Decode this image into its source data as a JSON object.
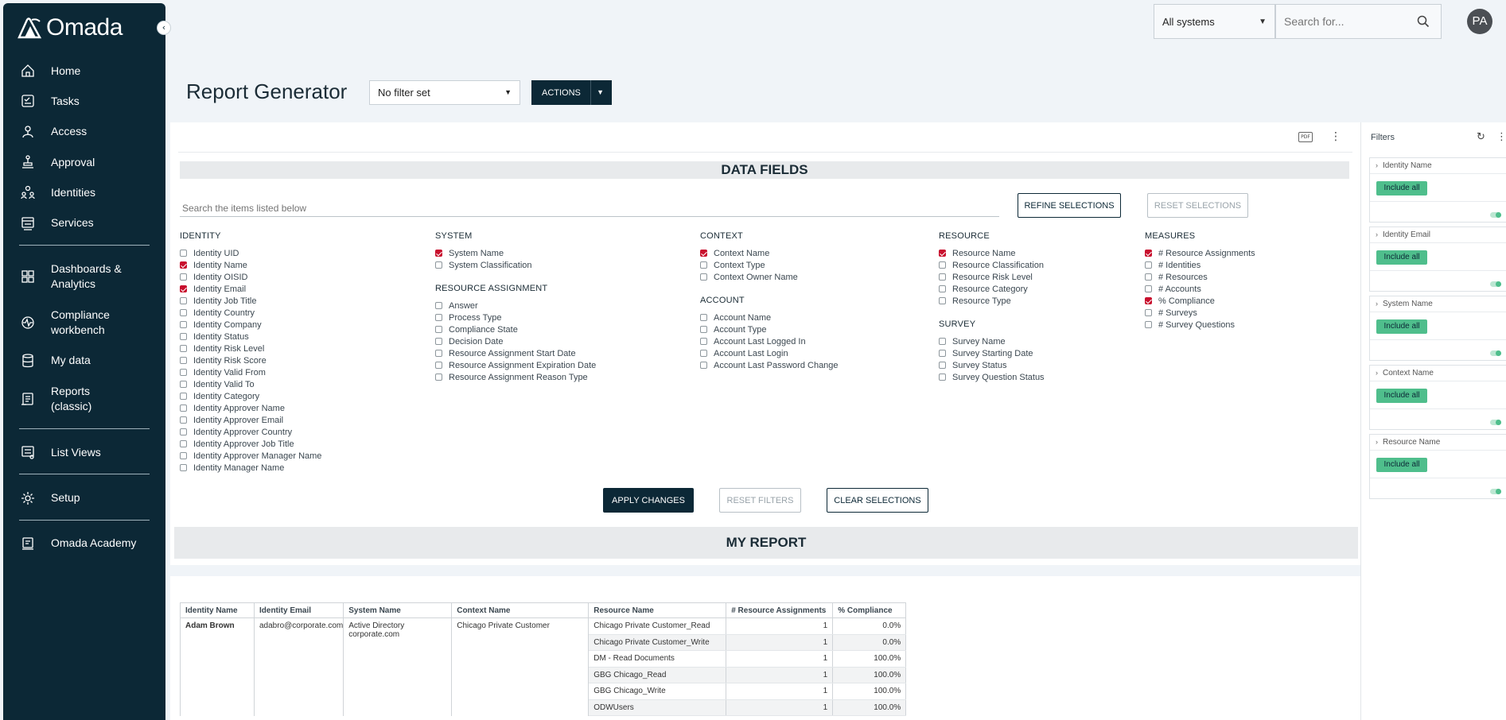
{
  "app": {
    "logo_text": "Omada"
  },
  "sidebar": {
    "items": [
      {
        "label": "Home",
        "icon": "home-icon"
      },
      {
        "label": "Tasks",
        "icon": "tasks-icon"
      },
      {
        "label": "Access",
        "icon": "access-icon"
      },
      {
        "label": "Approval",
        "icon": "approval-icon"
      },
      {
        "label": "Identities",
        "icon": "identities-icon"
      },
      {
        "label": "Services",
        "icon": "services-icon"
      },
      {
        "label": "Dashboards & Analytics",
        "icon": "dashboards-icon"
      },
      {
        "label": "Compliance workbench",
        "icon": "compliance-icon"
      },
      {
        "label": "My data",
        "icon": "database-icon"
      },
      {
        "label": "Reports (classic)",
        "icon": "reports-icon"
      },
      {
        "label": "List Views",
        "icon": "list-views-icon"
      },
      {
        "label": "Setup",
        "icon": "gear-icon"
      },
      {
        "label": "Omada Academy",
        "icon": "academy-icon"
      }
    ]
  },
  "topbar": {
    "system_select": "All systems",
    "search_placeholder": "Search for...",
    "avatar_initials": "PA"
  },
  "header": {
    "title": "Report Generator",
    "filter_select": "No filter set",
    "actions_label": "ACTIONS"
  },
  "data_fields": {
    "title": "DATA FIELDS",
    "search_placeholder": "Search the items listed below",
    "refine_label": "REFINE SELECTIONS",
    "reset_selections_label": "RESET SELECTIONS",
    "groups": {
      "identity": {
        "title": "IDENTITY",
        "items": [
          {
            "label": "Identity UID",
            "checked": false
          },
          {
            "label": "Identity Name",
            "checked": true
          },
          {
            "label": "Identity OISID",
            "checked": false
          },
          {
            "label": "Identity Email",
            "checked": true
          },
          {
            "label": "Identity Job Title",
            "checked": false
          },
          {
            "label": "Identity Country",
            "checked": false
          },
          {
            "label": "Identity Company",
            "checked": false
          },
          {
            "label": "Identity Status",
            "checked": false
          },
          {
            "label": "Identity Risk Level",
            "checked": false
          },
          {
            "label": "Identity Risk Score",
            "checked": false
          },
          {
            "label": "Identity Valid From",
            "checked": false
          },
          {
            "label": "Identity Valid To",
            "checked": false
          },
          {
            "label": "Identity Category",
            "checked": false
          },
          {
            "label": "Identity Approver Name",
            "checked": false
          },
          {
            "label": "Identity Approver Email",
            "checked": false
          },
          {
            "label": "Identity Approver Country",
            "checked": false
          },
          {
            "label": "Identity Approver Job Title",
            "checked": false
          },
          {
            "label": "Identity Approver Manager Name",
            "checked": false
          },
          {
            "label": "Identity Manager Name",
            "checked": false
          }
        ]
      },
      "system": {
        "title": "SYSTEM",
        "items": [
          {
            "label": "System Name",
            "checked": true
          },
          {
            "label": "System Classification",
            "checked": false
          }
        ]
      },
      "resource_assignment": {
        "title": "RESOURCE ASSIGNMENT",
        "items": [
          {
            "label": "Answer",
            "checked": false
          },
          {
            "label": "Process Type",
            "checked": false
          },
          {
            "label": "Compliance State",
            "checked": false
          },
          {
            "label": "Decision Date",
            "checked": false
          },
          {
            "label": "Resource Assignment Start Date",
            "checked": false
          },
          {
            "label": "Resource Assignment Expiration Date",
            "checked": false
          },
          {
            "label": "Resource Assignment Reason Type",
            "checked": false
          }
        ]
      },
      "context": {
        "title": "CONTEXT",
        "items": [
          {
            "label": "Context Name",
            "checked": true
          },
          {
            "label": "Context Type",
            "checked": false
          },
          {
            "label": "Context Owner Name",
            "checked": false
          }
        ]
      },
      "account": {
        "title": "ACCOUNT",
        "items": [
          {
            "label": "Account Name",
            "checked": false
          },
          {
            "label": "Account Type",
            "checked": false
          },
          {
            "label": "Account Last Logged In",
            "checked": false
          },
          {
            "label": "Account Last Login",
            "checked": false
          },
          {
            "label": "Account Last Password Change",
            "checked": false
          }
        ]
      },
      "resource": {
        "title": "RESOURCE",
        "items": [
          {
            "label": "Resource Name",
            "checked": true
          },
          {
            "label": "Resource Classification",
            "checked": false
          },
          {
            "label": "Resource Risk Level",
            "checked": false
          },
          {
            "label": "Resource Category",
            "checked": false
          },
          {
            "label": "Resource Type",
            "checked": false
          }
        ]
      },
      "survey": {
        "title": "SURVEY",
        "items": [
          {
            "label": "Survey Name",
            "checked": false
          },
          {
            "label": "Survey Starting Date",
            "checked": false
          },
          {
            "label": "Survey Status",
            "checked": false
          },
          {
            "label": "Survey Question Status",
            "checked": false
          }
        ]
      },
      "measures": {
        "title": "MEASURES",
        "items": [
          {
            "label": "# Resource Assignments",
            "checked": true
          },
          {
            "label": "# Identities",
            "checked": false
          },
          {
            "label": "# Resources",
            "checked": false
          },
          {
            "label": "# Accounts",
            "checked": false
          },
          {
            "label": "% Compliance",
            "checked": true
          },
          {
            "label": "# Surveys",
            "checked": false
          },
          {
            "label": "# Survey Questions",
            "checked": false
          }
        ]
      }
    },
    "apply_label": "APPLY CHANGES",
    "reset_filters_label": "RESET FILTERS",
    "clear_label": "CLEAR SELECTIONS"
  },
  "report": {
    "title": "MY REPORT",
    "columns": [
      "Identity Name",
      "Identity Email",
      "System Name",
      "Context Name",
      "Resource Name",
      "# Resource Assignments",
      "% Compliance"
    ],
    "group": {
      "identity_name": "Adam Brown",
      "identity_email": "adabro@corporate.com",
      "system_name": "Active Directory corporate.com",
      "context_name": "Chicago Private Customer"
    },
    "rows": [
      {
        "resource": "Chicago Private Customer_Read",
        "assignments": "1",
        "compliance": "0.0%"
      },
      {
        "resource": "Chicago Private Customer_Write",
        "assignments": "1",
        "compliance": "0.0%"
      },
      {
        "resource": "DM - Read Documents",
        "assignments": "1",
        "compliance": "100.0%"
      },
      {
        "resource": "GBG Chicago_Read",
        "assignments": "1",
        "compliance": "100.0%"
      },
      {
        "resource": "GBG Chicago_Write",
        "assignments": "1",
        "compliance": "100.0%"
      },
      {
        "resource": "ODWUsers",
        "assignments": "1",
        "compliance": "100.0%"
      }
    ]
  },
  "filters": {
    "title": "Filters",
    "cards": [
      {
        "name": "Identity Name",
        "include_label": "Include all"
      },
      {
        "name": "Identity Email",
        "include_label": "Include all"
      },
      {
        "name": "System Name",
        "include_label": "Include all"
      },
      {
        "name": "Context Name",
        "include_label": "Include all"
      },
      {
        "name": "Resource Name",
        "include_label": "Include all"
      }
    ]
  },
  "colors": {
    "brand_dark": "#0c2836",
    "checked_red": "#c8102e",
    "include_green": "#4fbe8c"
  }
}
